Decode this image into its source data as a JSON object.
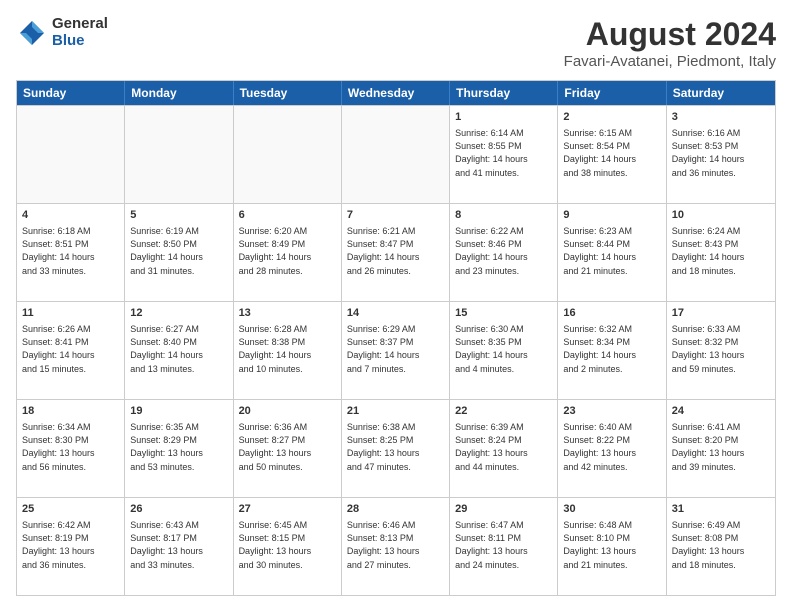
{
  "logo": {
    "general": "General",
    "blue": "Blue"
  },
  "title": "August 2024",
  "subtitle": "Favari-Avatanei, Piedmont, Italy",
  "header_days": [
    "Sunday",
    "Monday",
    "Tuesday",
    "Wednesday",
    "Thursday",
    "Friday",
    "Saturday"
  ],
  "weeks": [
    [
      {
        "day": "",
        "info": ""
      },
      {
        "day": "",
        "info": ""
      },
      {
        "day": "",
        "info": ""
      },
      {
        "day": "",
        "info": ""
      },
      {
        "day": "1",
        "info": "Sunrise: 6:14 AM\nSunset: 8:55 PM\nDaylight: 14 hours\nand 41 minutes."
      },
      {
        "day": "2",
        "info": "Sunrise: 6:15 AM\nSunset: 8:54 PM\nDaylight: 14 hours\nand 38 minutes."
      },
      {
        "day": "3",
        "info": "Sunrise: 6:16 AM\nSunset: 8:53 PM\nDaylight: 14 hours\nand 36 minutes."
      }
    ],
    [
      {
        "day": "4",
        "info": "Sunrise: 6:18 AM\nSunset: 8:51 PM\nDaylight: 14 hours\nand 33 minutes."
      },
      {
        "day": "5",
        "info": "Sunrise: 6:19 AM\nSunset: 8:50 PM\nDaylight: 14 hours\nand 31 minutes."
      },
      {
        "day": "6",
        "info": "Sunrise: 6:20 AM\nSunset: 8:49 PM\nDaylight: 14 hours\nand 28 minutes."
      },
      {
        "day": "7",
        "info": "Sunrise: 6:21 AM\nSunset: 8:47 PM\nDaylight: 14 hours\nand 26 minutes."
      },
      {
        "day": "8",
        "info": "Sunrise: 6:22 AM\nSunset: 8:46 PM\nDaylight: 14 hours\nand 23 minutes."
      },
      {
        "day": "9",
        "info": "Sunrise: 6:23 AM\nSunset: 8:44 PM\nDaylight: 14 hours\nand 21 minutes."
      },
      {
        "day": "10",
        "info": "Sunrise: 6:24 AM\nSunset: 8:43 PM\nDaylight: 14 hours\nand 18 minutes."
      }
    ],
    [
      {
        "day": "11",
        "info": "Sunrise: 6:26 AM\nSunset: 8:41 PM\nDaylight: 14 hours\nand 15 minutes."
      },
      {
        "day": "12",
        "info": "Sunrise: 6:27 AM\nSunset: 8:40 PM\nDaylight: 14 hours\nand 13 minutes."
      },
      {
        "day": "13",
        "info": "Sunrise: 6:28 AM\nSunset: 8:38 PM\nDaylight: 14 hours\nand 10 minutes."
      },
      {
        "day": "14",
        "info": "Sunrise: 6:29 AM\nSunset: 8:37 PM\nDaylight: 14 hours\nand 7 minutes."
      },
      {
        "day": "15",
        "info": "Sunrise: 6:30 AM\nSunset: 8:35 PM\nDaylight: 14 hours\nand 4 minutes."
      },
      {
        "day": "16",
        "info": "Sunrise: 6:32 AM\nSunset: 8:34 PM\nDaylight: 14 hours\nand 2 minutes."
      },
      {
        "day": "17",
        "info": "Sunrise: 6:33 AM\nSunset: 8:32 PM\nDaylight: 13 hours\nand 59 minutes."
      }
    ],
    [
      {
        "day": "18",
        "info": "Sunrise: 6:34 AM\nSunset: 8:30 PM\nDaylight: 13 hours\nand 56 minutes."
      },
      {
        "day": "19",
        "info": "Sunrise: 6:35 AM\nSunset: 8:29 PM\nDaylight: 13 hours\nand 53 minutes."
      },
      {
        "day": "20",
        "info": "Sunrise: 6:36 AM\nSunset: 8:27 PM\nDaylight: 13 hours\nand 50 minutes."
      },
      {
        "day": "21",
        "info": "Sunrise: 6:38 AM\nSunset: 8:25 PM\nDaylight: 13 hours\nand 47 minutes."
      },
      {
        "day": "22",
        "info": "Sunrise: 6:39 AM\nSunset: 8:24 PM\nDaylight: 13 hours\nand 44 minutes."
      },
      {
        "day": "23",
        "info": "Sunrise: 6:40 AM\nSunset: 8:22 PM\nDaylight: 13 hours\nand 42 minutes."
      },
      {
        "day": "24",
        "info": "Sunrise: 6:41 AM\nSunset: 8:20 PM\nDaylight: 13 hours\nand 39 minutes."
      }
    ],
    [
      {
        "day": "25",
        "info": "Sunrise: 6:42 AM\nSunset: 8:19 PM\nDaylight: 13 hours\nand 36 minutes."
      },
      {
        "day": "26",
        "info": "Sunrise: 6:43 AM\nSunset: 8:17 PM\nDaylight: 13 hours\nand 33 minutes."
      },
      {
        "day": "27",
        "info": "Sunrise: 6:45 AM\nSunset: 8:15 PM\nDaylight: 13 hours\nand 30 minutes."
      },
      {
        "day": "28",
        "info": "Sunrise: 6:46 AM\nSunset: 8:13 PM\nDaylight: 13 hours\nand 27 minutes."
      },
      {
        "day": "29",
        "info": "Sunrise: 6:47 AM\nSunset: 8:11 PM\nDaylight: 13 hours\nand 24 minutes."
      },
      {
        "day": "30",
        "info": "Sunrise: 6:48 AM\nSunset: 8:10 PM\nDaylight: 13 hours\nand 21 minutes."
      },
      {
        "day": "31",
        "info": "Sunrise: 6:49 AM\nSunset: 8:08 PM\nDaylight: 13 hours\nand 18 minutes."
      }
    ]
  ]
}
